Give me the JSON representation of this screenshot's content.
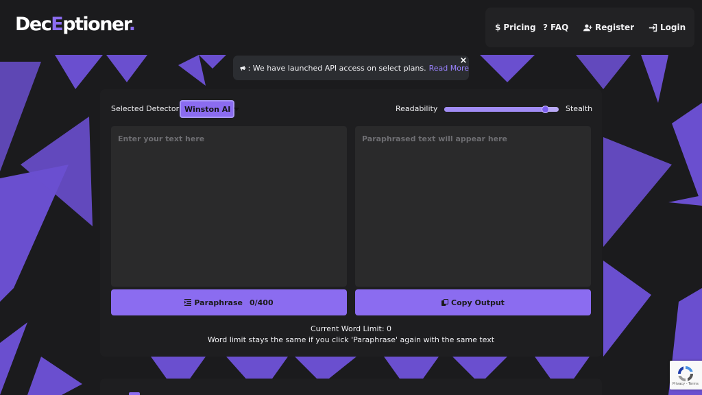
{
  "logo": {
    "part1": "Dec",
    "accent": "E",
    "part2": "ptioner",
    "dot": "."
  },
  "nav": {
    "pricing": "Pricing",
    "faq": "FAQ",
    "register": "Register",
    "login": "Login"
  },
  "announcement": {
    "text": ": We have launched API access on select plans.",
    "link": "Read More",
    "close": "×"
  },
  "detector": {
    "label": "Selected Detector:",
    "selected": "Winston AI"
  },
  "slider": {
    "left_label": "Readability",
    "right_label": "Stealth",
    "value": 0.88
  },
  "input": {
    "placeholder": "Enter your text here"
  },
  "output": {
    "placeholder": "Paraphrased text will appear here"
  },
  "buttons": {
    "paraphrase": "Paraphrase",
    "paraphrase_count": "0/400",
    "copy": "Copy Output"
  },
  "info": {
    "word_limit": "Current Word Limit: 0",
    "note": "Word limit stays the same if you click 'Paraphrase' again with the same text"
  },
  "recaptcha": {
    "terms": "Privacy - Terms"
  },
  "colors": {
    "accent": "#8b6cf0",
    "background": "#1b1b1d",
    "panel": "#1e1e20",
    "textarea": "#2a2a2b"
  }
}
